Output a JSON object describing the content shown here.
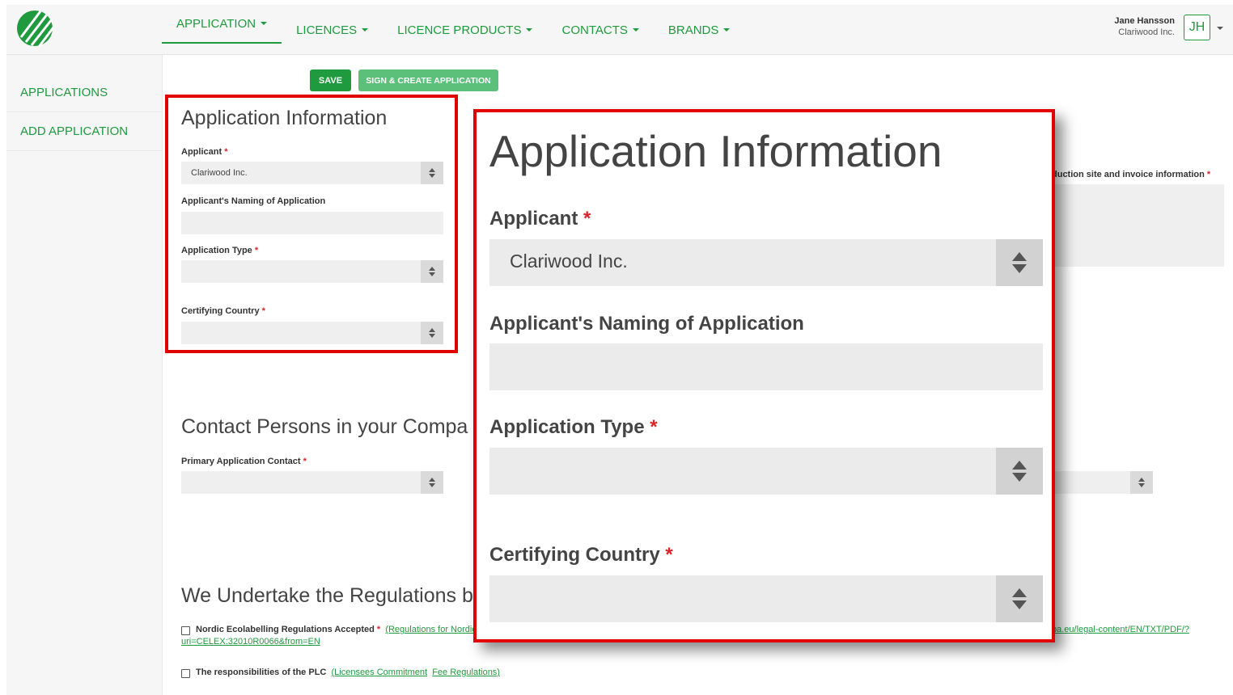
{
  "colors": {
    "brand": "#1f9a3e",
    "brand_light": "#5cc07a",
    "highlight": "#e00000"
  },
  "topnav": {
    "items": [
      {
        "label": "APPLICATION"
      },
      {
        "label": "LICENCES"
      },
      {
        "label": "LICENCE PRODUCTS"
      },
      {
        "label": "CONTACTS"
      },
      {
        "label": "BRANDS"
      }
    ]
  },
  "user": {
    "name": "Jane Hansson",
    "company": "Clariwood Inc.",
    "initials": "JH"
  },
  "sidebar": {
    "items": [
      {
        "label": "APPLICATIONS"
      },
      {
        "label": "ADD APPLICATION"
      }
    ]
  },
  "toolbar": {
    "save_label": "SAVE",
    "sign_label": "SIGN & CREATE APPLICATION"
  },
  "app_info": {
    "title": "Application Information",
    "applicant_label": "Applicant",
    "applicant_value": "Clariwood Inc.",
    "naming_label": "Applicant's Naming of Application",
    "type_label": "Application Type",
    "country_label": "Certifying Country",
    "required_mark": "*"
  },
  "contacts": {
    "title": "Contact Persons in your Compa",
    "primary_label": "Primary Application Contact"
  },
  "right_panel": {
    "label_partial": "duction site and invoice information"
  },
  "regulations": {
    "title": "We Undertake the Regulations b",
    "item1_text": "Nordic Ecolabelling Regulations Accepted",
    "item1_link": "(Regulations for Nordic E",
    "item1_url_cont": "uri=CELEX:32010R0066&from=EN",
    "item1_right_link": "pa.eu/legal-content/EN/TXT/PDF/?",
    "item2_text": "The responsibilities of the PLC",
    "item2_link1": "(Licensees Commitment",
    "item2_link2": "Fee Regulations)"
  }
}
